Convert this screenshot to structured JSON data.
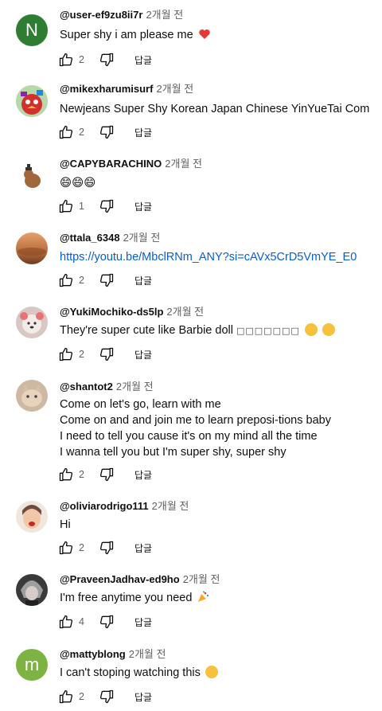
{
  "reply_label": "답글",
  "comments": [
    {
      "author": "@user-ef9zu8ii7r",
      "time": "2개월 전",
      "lines": [
        "Super shy i am please me"
      ],
      "likes": "2",
      "emoji": "heart-emoji",
      "avatar": {
        "letter": "N",
        "bg": "#2e7d32"
      }
    },
    {
      "author": "@mikexharumisurf",
      "time": "2개월 전",
      "lines": [
        "Newjeans Super Shy Korean Japan Chinese YinYueTai Com"
      ],
      "likes": "2"
    },
    {
      "author": "@CAPYBARACHINO",
      "time": "2개월 전",
      "lines": [
        "😄😄😄"
      ],
      "likes": "1"
    },
    {
      "author": "@ttala_6348",
      "time": "2개월 전",
      "lines": [
        "https://youtu.be/MbclRNm_ANY?si=cAVx5CrD5VmYE_E0"
      ],
      "likes": "2",
      "link": true
    },
    {
      "author": "@YukiMochiko-ds5lp",
      "time": "2개월 전",
      "lines": [
        "They're super cute like Barbie doll"
      ],
      "boxes": "□□□□□□□",
      "likes": "2"
    },
    {
      "author": "@shantot2",
      "time": "2개월 전",
      "lines": [
        "Come on let's go, learn with me",
        "Come on and and join me to learn preposi-tions baby",
        "I need to tell you cause it's on my mind all the time",
        "I wanna tell you but I'm super shy, super shy"
      ],
      "likes": "2"
    },
    {
      "author": "@oliviarodrigo111",
      "time": "2개월 전",
      "lines": [
        "Hi"
      ],
      "likes": "2"
    },
    {
      "author": "@PraveenJadhav-ed9ho",
      "time": "2개월 전",
      "lines": [
        "I'm free anytime you need"
      ],
      "likes": "4",
      "emoji": "party-popper-emoji"
    },
    {
      "author": "@mattyblong",
      "time": "2개월 전",
      "lines": [
        "I can't stoping watching this"
      ],
      "likes": "2",
      "emoji": "laughing-emoji",
      "avatar": {
        "letter": "m",
        "bg": "#7cb342"
      }
    }
  ]
}
